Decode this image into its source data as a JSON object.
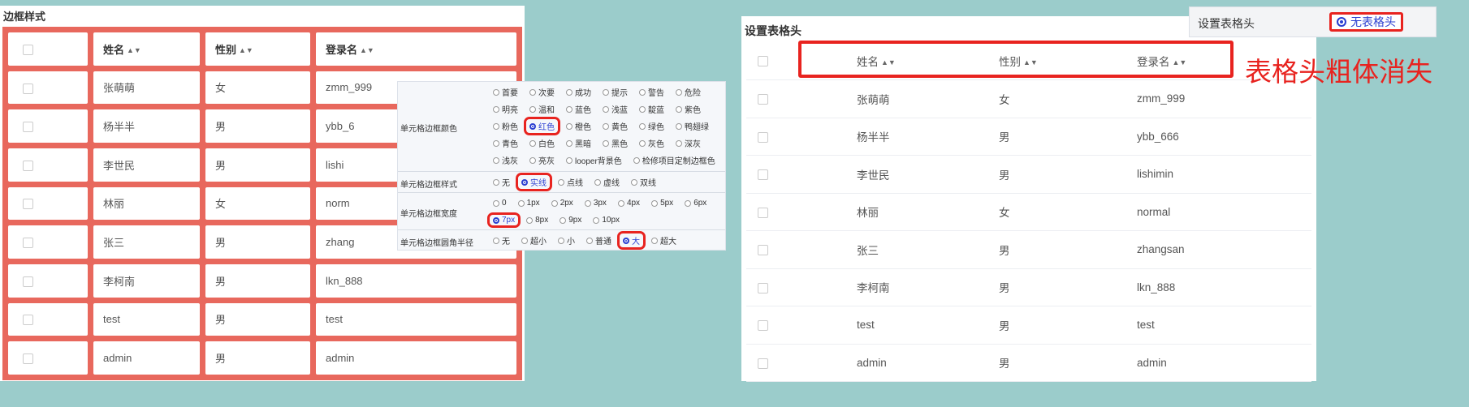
{
  "left": {
    "title": "边框样式",
    "columns": [
      "姓名",
      "性别",
      "登录名"
    ],
    "rows": [
      {
        "name": "张萌萌",
        "gender": "女",
        "login": "zmm_999"
      },
      {
        "name": "杨半半",
        "gender": "男",
        "login": "ybb_6"
      },
      {
        "name": "李世民",
        "gender": "男",
        "login": "lishi"
      },
      {
        "name": "林丽",
        "gender": "女",
        "login": "norm"
      },
      {
        "name": "张三",
        "gender": "男",
        "login": "zhang"
      },
      {
        "name": "李柯南",
        "gender": "男",
        "login": "lkn_888"
      },
      {
        "name": "test",
        "gender": "男",
        "login": "test"
      },
      {
        "name": "admin",
        "gender": "男",
        "login": "admin"
      }
    ]
  },
  "options": {
    "color": {
      "label": "单元格边框颜色",
      "lines": [
        [
          "首要",
          "次要",
          "成功",
          "提示",
          "警告",
          "危险"
        ],
        [
          "明亮",
          "温和",
          "蓝色",
          "浅蓝",
          "靛蓝",
          "紫色"
        ],
        [
          "粉色",
          "红色",
          "橙色",
          "黄色",
          "绿色",
          "鸭翅绿"
        ],
        [
          "青色",
          "白色",
          "黑暗",
          "黑色",
          "灰色",
          "深灰"
        ],
        [
          "浅灰",
          "亮灰",
          "looper背景色",
          "检修项目定制边框色"
        ]
      ],
      "selected": "红色"
    },
    "style": {
      "label": "单元格边框样式",
      "items": [
        "无",
        "实线",
        "点线",
        "虚线",
        "双线"
      ],
      "selected": "实线"
    },
    "width": {
      "label": "单元格边框宽度",
      "lines": [
        [
          "0",
          "1px",
          "2px",
          "3px",
          "4px",
          "5px",
          "6px"
        ],
        [
          "7px",
          "8px",
          "9px",
          "10px"
        ]
      ],
      "selected": "7px"
    },
    "radius": {
      "label": "单元格边框圆角半径",
      "items": [
        "无",
        "超小",
        "小",
        "普通",
        "大",
        "超大"
      ],
      "selected": "大"
    }
  },
  "right": {
    "title": "设置表格头",
    "columns": [
      "姓名",
      "性别",
      "登录名"
    ],
    "rows": [
      {
        "name": "张萌萌",
        "gender": "女",
        "login": "zmm_999"
      },
      {
        "name": "杨半半",
        "gender": "男",
        "login": "ybb_666"
      },
      {
        "name": "李世民",
        "gender": "男",
        "login": "lishimin"
      },
      {
        "name": "林丽",
        "gender": "女",
        "login": "normal"
      },
      {
        "name": "张三",
        "gender": "男",
        "login": "zhangsan"
      },
      {
        "name": "李柯南",
        "gender": "男",
        "login": "lkn_888"
      },
      {
        "name": "test",
        "gender": "男",
        "login": "test"
      },
      {
        "name": "admin",
        "gender": "男",
        "login": "admin"
      }
    ]
  },
  "setting": {
    "label": "设置表格头",
    "option": "无表格头"
  },
  "annotation": "表格头粗体消失",
  "colors": {
    "background": "#9bcccb",
    "border_red": "#e8685d",
    "highlight": "#e8231f",
    "radio_blue": "#2b3fd1"
  }
}
